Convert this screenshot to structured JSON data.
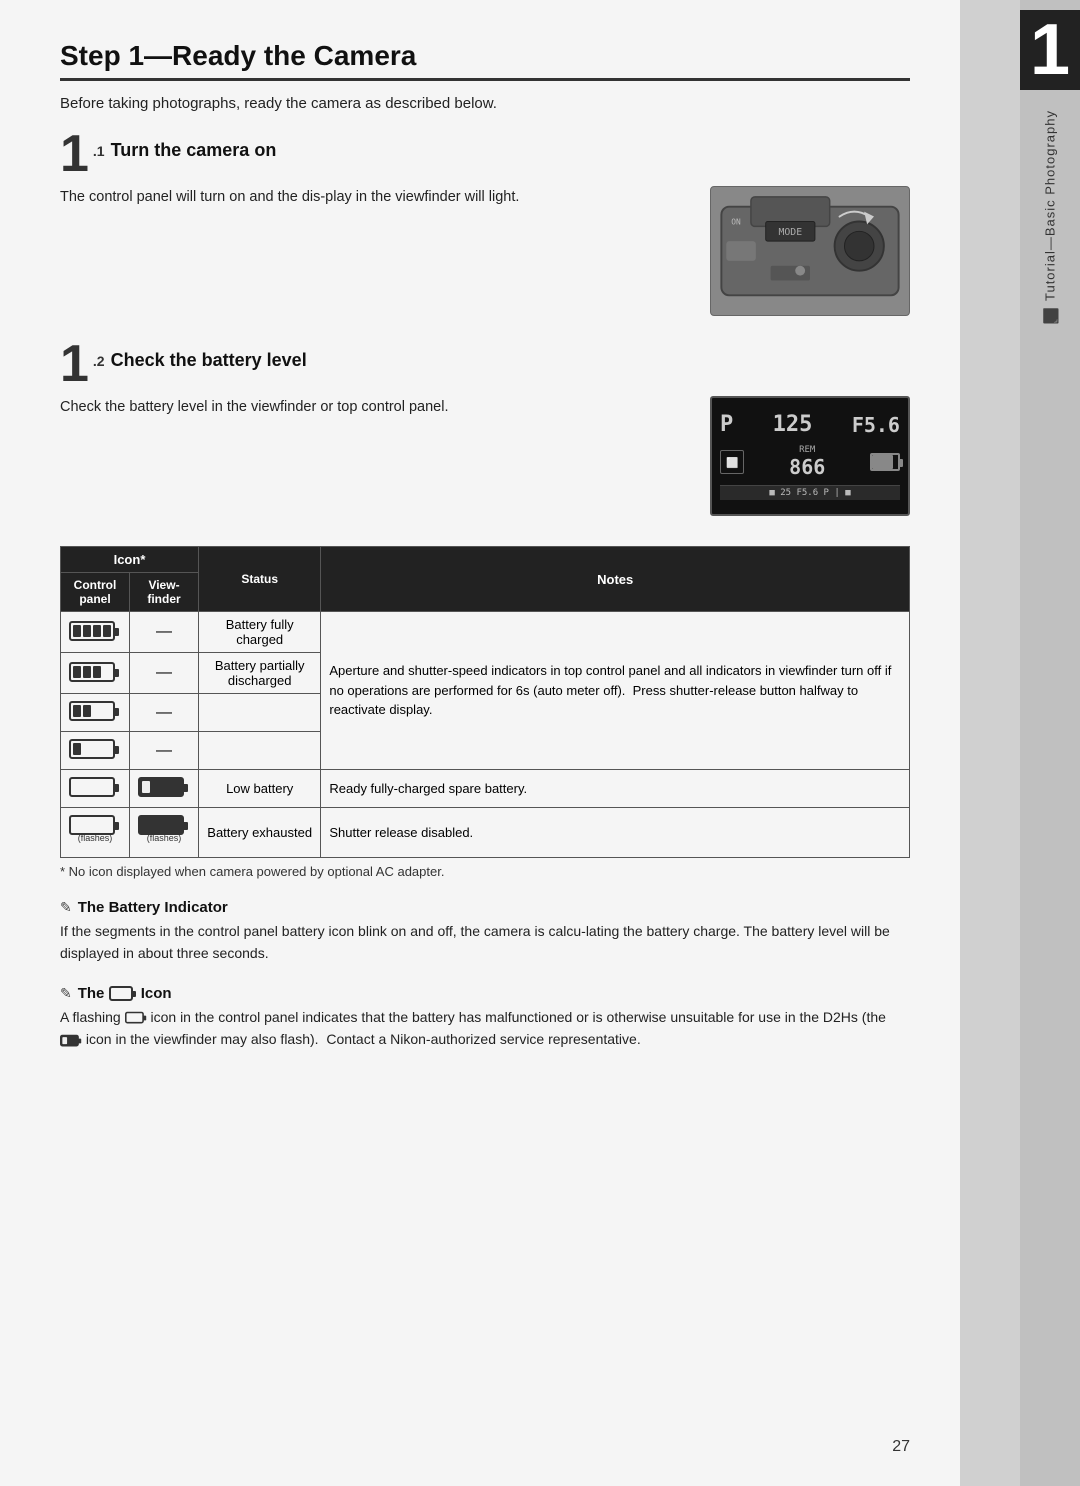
{
  "page": {
    "title": "Step 1—Ready the Camera",
    "intro": "Before taking photographs, ready the camera as described below.",
    "step_number_label": "27",
    "tab_number": "1",
    "tab_label": "Tutorial—Basic Photography"
  },
  "steps": [
    {
      "number": "1",
      "sub": ".1",
      "title": "Turn the camera on",
      "body": "The control panel will turn on and the dis-play in the viewfinder will light."
    },
    {
      "number": "1",
      "sub": ".2",
      "title": "Check the battery level",
      "body": "Check the battery level in the viewfinder or top control panel."
    }
  ],
  "table": {
    "header_icon": "Icon*",
    "col_control": "Control panel",
    "col_finder": "View-finder",
    "col_status": "Status",
    "col_notes": "Notes",
    "rows": [
      {
        "control_icon": "full_battery",
        "finder": "—",
        "status": "Battery fully charged",
        "notes": "Aperture and shutter-speed indicators in top control panel and all indicators in viewfinder turn off if no operations are performed for 6s (auto meter off).  Press shutter-release button halfway to reactivate display.",
        "notes_rowspan": 4
      },
      {
        "control_icon": "high_battery",
        "finder": "—",
        "status": "Battery partially discharged",
        "notes_merged": true
      },
      {
        "control_icon": "med_battery",
        "finder": "—",
        "status": null,
        "notes_merged": true
      },
      {
        "control_icon": "low_battery_small",
        "finder": "—",
        "status": null,
        "notes_merged": true
      },
      {
        "control_icon": "low_battery_empty",
        "finder": "low_battery_finder",
        "status": "Low battery",
        "notes": "Ready fully-charged spare battery."
      },
      {
        "control_icon": "exhausted_battery",
        "finder": "exhausted_finder",
        "status": "Battery exhausted",
        "notes": "Shutter release disabled.",
        "control_label": "(flashes)",
        "finder_label": "(flashes)"
      }
    ],
    "footnote": "* No icon displayed when camera powered by optional AC adapter."
  },
  "note_sections": [
    {
      "title": "The Battery Indicator",
      "body": "If the segments in the control panel battery icon blink on and off, the camera is calcu-lating the battery charge.  The battery level will be displayed in about three seconds."
    },
    {
      "title": "The ☐ Icon",
      "title_prefix": "The ",
      "title_suffix": " Icon",
      "body": "A flashing ☐ icon in the control panel indicates that the battery has malfunctioned or is otherwise unsuitable for use in the D2Hs (the ☐ icon in the viewfinder may also flash).  Contact a Nikon-authorized service representative."
    }
  ]
}
